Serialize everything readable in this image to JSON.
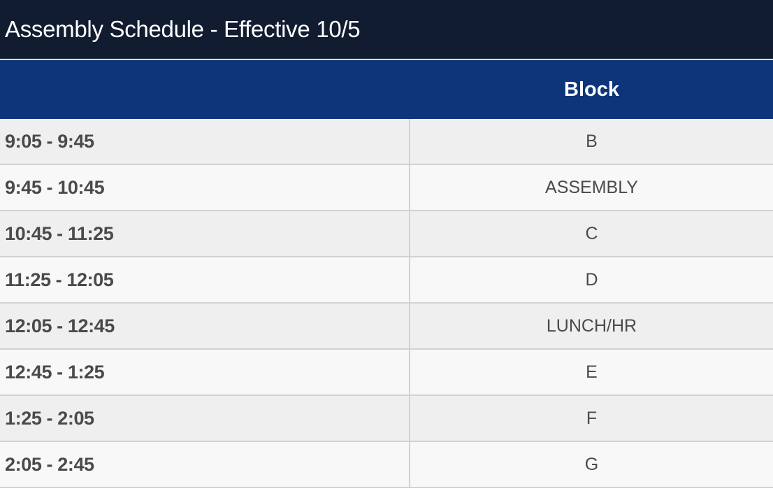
{
  "title": "Assembly Schedule - Effective 10/5",
  "table": {
    "headers": {
      "time": "",
      "block": "Block"
    },
    "rows": [
      {
        "time": "9:05 - 9:45",
        "block": "B"
      },
      {
        "time": "9:45 - 10:45",
        "block": "ASSEMBLY"
      },
      {
        "time": "10:45 - 11:25",
        "block": "C"
      },
      {
        "time": "11:25 - 12:05",
        "block": "D"
      },
      {
        "time": "12:05 - 12:45",
        "block": "LUNCH/HR"
      },
      {
        "time": "12:45 - 1:25",
        "block": "E"
      },
      {
        "time": "1:25 - 2:05",
        "block": "F"
      },
      {
        "time": "2:05 - 2:45",
        "block": "G"
      }
    ]
  },
  "colors": {
    "title_bg": "#121c30",
    "header_bg": "#0e357a",
    "row_odd_bg": "#efefef",
    "row_even_bg": "#f8f8f8",
    "text": "#4a4a4a"
  }
}
